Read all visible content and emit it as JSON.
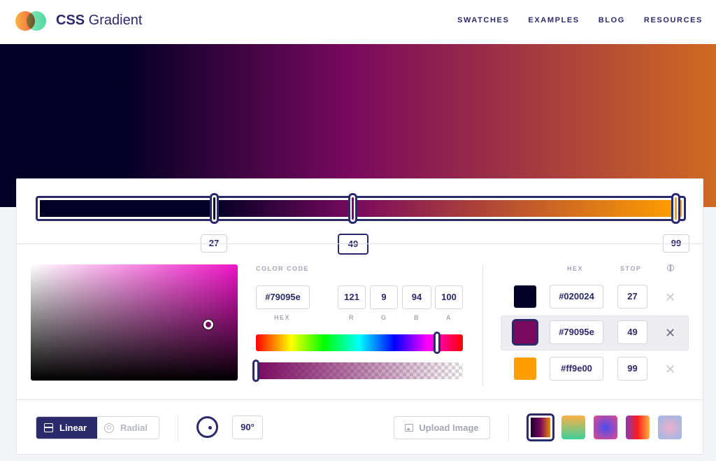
{
  "header": {
    "brand_bold": "CSS",
    "brand_rest": " Gradient",
    "nav": [
      "SWATCHES",
      "EXAMPLES",
      "BLOG",
      "RESOURCES"
    ]
  },
  "stops_bar": {
    "labels": [
      "27",
      "49",
      "99"
    ]
  },
  "color_code": {
    "heading": "COLOR CODE",
    "hex": "#79095e",
    "r": "121",
    "g": "9",
    "b": "94",
    "a": "100",
    "labels": [
      "HEX",
      "R",
      "G",
      "B",
      "A"
    ]
  },
  "stops_table": {
    "headers": [
      "HEX",
      "STOP"
    ],
    "rows": [
      {
        "hex": "#020024",
        "stop": "27",
        "color": "#020024"
      },
      {
        "hex": "#79095e",
        "stop": "49",
        "color": "#79095e"
      },
      {
        "hex": "#ff9e00",
        "stop": "99",
        "color": "#ff9e00"
      }
    ],
    "remove_glyph": "✕"
  },
  "toolbar": {
    "linear_label": "Linear",
    "radial_label": "Radial",
    "angle": "90°",
    "upload_label": "Upload Image"
  },
  "colors": {
    "accent": "#2b2a6a",
    "gradient": [
      "#020024",
      "#79095e",
      "#ff9e00"
    ]
  },
  "icons": [
    "logo-icon",
    "globe-icon",
    "linear-icon",
    "radial-icon",
    "angle-dial-icon",
    "image-icon",
    "remove-icon"
  ]
}
